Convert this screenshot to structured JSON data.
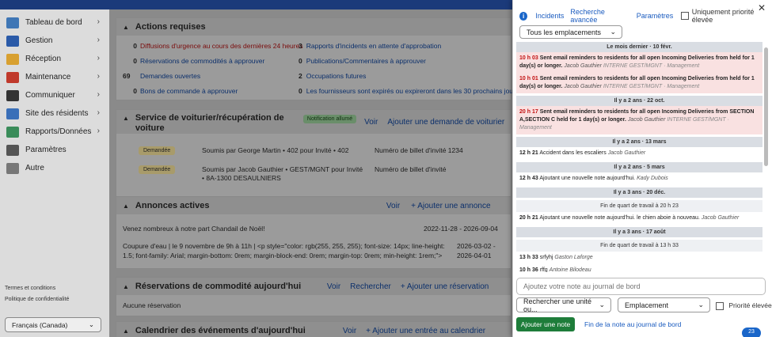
{
  "sidebar": {
    "items": [
      {
        "label": "Tableau de bord",
        "icon": "dashboard-icon",
        "color": "#3f76b5"
      },
      {
        "label": "Gestion",
        "icon": "building-icon",
        "color": "#2a5aa8"
      },
      {
        "label": "Réception",
        "icon": "bell-icon",
        "color": "#d8a030"
      },
      {
        "label": "Maintenance",
        "icon": "toolbox-icon",
        "color": "#c0392b"
      },
      {
        "label": "Communiquer",
        "icon": "megaphone-icon",
        "color": "#333333"
      },
      {
        "label": "Site des résidents",
        "icon": "house-icon",
        "color": "#3a6fb8"
      },
      {
        "label": "Rapports/Données",
        "icon": "chart-icon",
        "color": "#3a8c5a"
      },
      {
        "label": "Paramètres",
        "icon": "gear-icon",
        "color": "#555555"
      },
      {
        "label": "Autre",
        "icon": "more-icon",
        "color": "#777777"
      }
    ],
    "terms": "Termes et conditions",
    "privacy": "Politique de confidentialité",
    "language": "Français (Canada)"
  },
  "actions": {
    "title": "Actions requises",
    "left": [
      {
        "count": "0",
        "label": "Diffusions d'urgence au cours des dernières 24 heures"
      },
      {
        "count": "0",
        "label": "Réservations de commodités à approuver"
      },
      {
        "count": "69",
        "label": "Demandes ouvertes"
      },
      {
        "count": "0",
        "label": "Bons de commande à approuver"
      }
    ],
    "right": [
      {
        "count": "3",
        "label": "Rapports d'incidents en attente d'approbation"
      },
      {
        "count": "0",
        "label": "Publications/Commentaires à approuver"
      },
      {
        "count": "2",
        "label": "Occupations futures"
      },
      {
        "count": "0",
        "label": "Les fournisseurs sont expirés ou expireront dans les 30 prochains jours"
      }
    ]
  },
  "valet": {
    "title": "Service de voiturier/récupération de voiture",
    "notification": "Notification allumé",
    "view": "Voir",
    "add": "Ajouter une demande de voiturier",
    "rows": [
      {
        "status": "Demandée",
        "by": "Soumis par George Martin • 402 pour Invité • 402",
        "ticket": "Numéro de billet d'invité 1234"
      },
      {
        "status": "Demandée",
        "by": "Soumis par Jacob Gauthier • GEST/MGNT pour Invité • 8A-1300 DESAULNIERS",
        "ticket": "Numéro de billet d'invité"
      }
    ]
  },
  "announcements": {
    "title": "Annonces actives",
    "view": "Voir",
    "add": "+ Ajouter une annonce",
    "items": [
      {
        "text": "Venez nombreux à notre part Chandail de Noël!",
        "dates": "2022-11-28 - 2026-09-04"
      },
      {
        "text": "Coupure d'eau | le 9 novembre de 9h à 11h | <p style=\"color: rgb(255, 255, 255); font-size: 14px; line-height: 1.5; font-family: Arial; margin-bottom: 0rem; margin-block-end: 0rem; margin-top: 0rem; min-height: 1rem;\">",
        "dates": "2026-03-02 - 2026-04-01"
      }
    ]
  },
  "reservations": {
    "title": "Réservations de commodité aujourd'hui",
    "view": "Voir",
    "search": "Rechercher",
    "add": "+ Ajouter une réservation",
    "empty": "Aucune réservation"
  },
  "calendar": {
    "title": "Calendrier des événements d'aujourd'hui",
    "view": "Voir",
    "add": "+ Ajouter une entrée au calendrier"
  },
  "panel": {
    "tabs": [
      "Incidents",
      "Recherche avancée",
      "Paramètres"
    ],
    "priority_only": "Uniquement priorité élevée",
    "location_filter": "Tous les emplacements",
    "note_placeholder": "Ajoutez votre note au journal de bord",
    "unit_search": "Rechercher une unité ou...",
    "location": "Emplacement",
    "high_priority": "Priorité élevée",
    "add_note": "Ajouter une note",
    "end_note": "Fin de la note au journal de bord",
    "badge": "23",
    "feed": [
      {
        "kind": "header",
        "text": "Le mois dernier · 10 févr."
      },
      {
        "kind": "entry",
        "pink": true,
        "time": "10 h 03",
        "text": "Sent email reminders to residents for all open Incoming Deliveries from held for 1 day(s) or longer.",
        "author": "Jacob Gauthier",
        "dept": "INTERNE GEST/MGNT · Management"
      },
      {
        "kind": "entry",
        "pink": true,
        "time": "10 h 01",
        "text": "Sent email reminders to residents for all open Incoming Deliveries from held for 1 day(s) or longer.",
        "author": "Jacob Gauthier",
        "dept": "INTERNE GEST/MGNT · Management"
      },
      {
        "kind": "header",
        "text": "Il y a 2 ans · 22 oct."
      },
      {
        "kind": "entry",
        "pink": true,
        "time": "20 h 17",
        "text": "Sent email reminders to residents for all open Incoming Deliveries from SECTION A,SECTION C held for 1 day(s) or longer.",
        "author": "Jacob Gauthier",
        "dept": "INTERNE GEST/MGNT · Management"
      },
      {
        "kind": "header",
        "text": "Il y a 2 ans · 13 mars"
      },
      {
        "kind": "entry",
        "pink": false,
        "time": "12 h 21",
        "text": "Accident dans les escaliers",
        "author": "Jacob Gauthier",
        "dept": ""
      },
      {
        "kind": "header",
        "text": "Il y a 2 ans · 5 mars"
      },
      {
        "kind": "entry",
        "pink": false,
        "time": "12 h 43",
        "text": "Ajoutant une nouvelle note aujourd'hui.",
        "author": "Kady Dubois",
        "dept": ""
      },
      {
        "kind": "header",
        "text": "Il y a 3 ans · 20 déc."
      },
      {
        "kind": "shift",
        "text": "Fin de quart de travail à 20 h 23"
      },
      {
        "kind": "entry",
        "pink": false,
        "time": "20 h 21",
        "text": "Ajoutant une nouvelle note aujourd'hui. le chien aboie à nouveau.",
        "author": "Jacob Gauthier",
        "dept": ""
      },
      {
        "kind": "header",
        "text": "Il y a 3 ans · 17 août"
      },
      {
        "kind": "shift",
        "text": "Fin de quart de travail à 13 h 33"
      },
      {
        "kind": "entry",
        "pink": false,
        "time": "13 h 33",
        "text": "srfyhj",
        "author": "Gaston Laforge",
        "dept": ""
      },
      {
        "kind": "entry",
        "pink": false,
        "time": "10 h 36",
        "text": "rffg",
        "author": "Antoine Bilodeau",
        "dept": ""
      }
    ]
  }
}
